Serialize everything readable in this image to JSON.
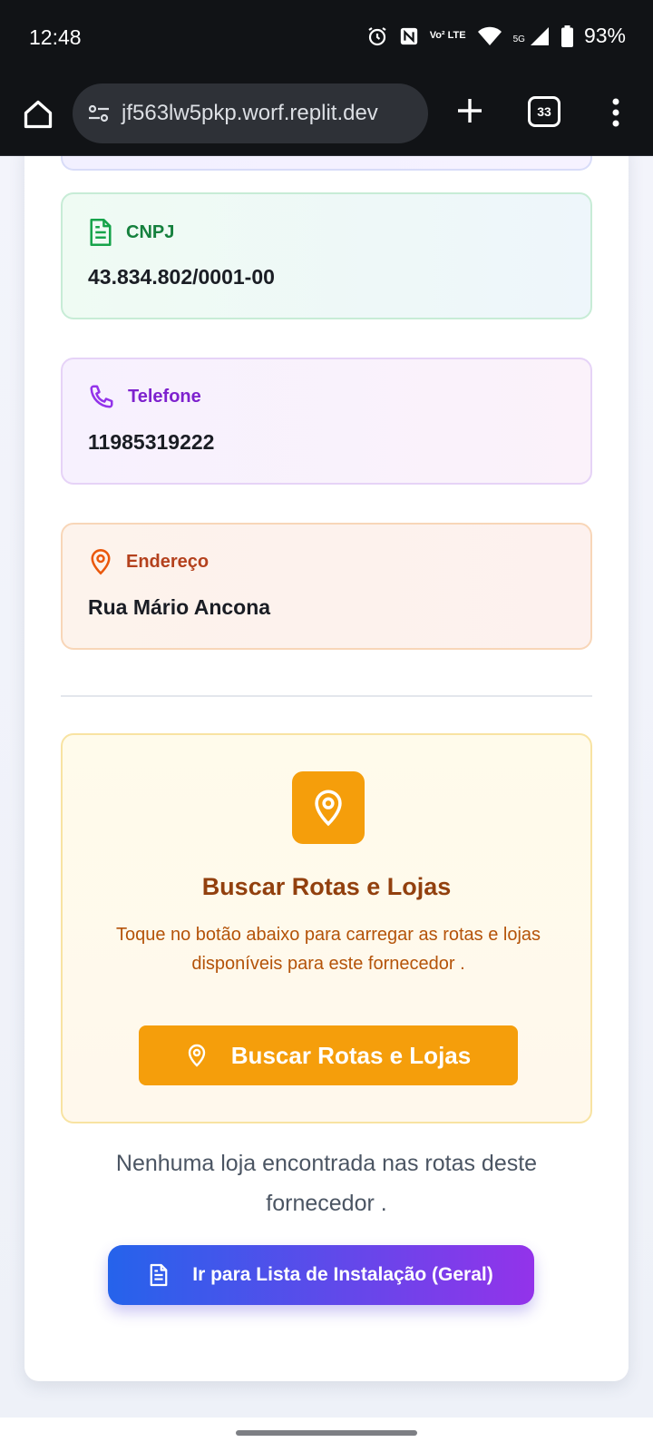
{
  "status_bar": {
    "time": "12:48",
    "lte_label": "Vo² LTE",
    "network": "5G",
    "battery": "93%",
    "icons": [
      "alarm-icon",
      "nfc-icon",
      "volte-icon",
      "wifi-icon",
      "signal-icon",
      "battery-icon"
    ]
  },
  "browser": {
    "url": "jf563lw5pkp.worf.replit.dev",
    "tab_count": "33"
  },
  "info_cards": {
    "cnpj": {
      "label": "CNPJ",
      "value": "43.834.802/0001-00"
    },
    "telefone": {
      "label": "Telefone",
      "value": "11985319222"
    },
    "endereco": {
      "label": "Endereço",
      "value": "Rua Mário Ancona"
    }
  },
  "search_section": {
    "title": "Buscar Rotas e Lojas",
    "description": "Toque no botão abaixo para carregar as rotas e lojas disponíveis para este fornecedor .",
    "button_label": "Buscar Rotas e Lojas"
  },
  "empty_message": "Nenhuma loja encontrada nas rotas deste fornecedor .",
  "install_button_label": "Ir para Lista de Instalação (Geral)",
  "colors": {
    "amber": "#f59e0b",
    "green": "#15803d",
    "purple": "#7e22ce",
    "orange": "#b4411d",
    "gradient_start": "#2563eb",
    "gradient_end": "#9333ea"
  }
}
